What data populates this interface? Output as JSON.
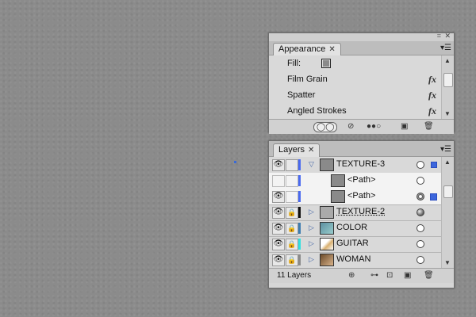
{
  "appearance": {
    "tab_label": "Appearance",
    "rows": [
      {
        "label": "Fill:"
      },
      {
        "label": "Film Grain",
        "icon": "fx-icon"
      },
      {
        "label": "Spatter",
        "icon": "fx-icon"
      },
      {
        "label": "Angled Strokes",
        "icon": "fx-icon"
      }
    ],
    "fx_symbol": "fx"
  },
  "layers": {
    "tab_label": "Layers",
    "rows": [
      {
        "name": "TEXTURE-3",
        "color": "#4a6af0"
      },
      {
        "name": "<Path>",
        "color": "#4a6af0"
      },
      {
        "name": "<Path>",
        "color": "#4a6af0"
      },
      {
        "name": "TEXTURE-2",
        "color": "#111111"
      },
      {
        "name": "COLOR",
        "color": "#3d7cb0"
      },
      {
        "name": "GUITAR",
        "color": "#30e0e0"
      },
      {
        "name": "WOMAN",
        "color": "#8a8a8a"
      }
    ],
    "count_text": "11 Layers"
  },
  "colors": {
    "selection": "#3c66dc",
    "canvas": "#8b8b8b"
  }
}
